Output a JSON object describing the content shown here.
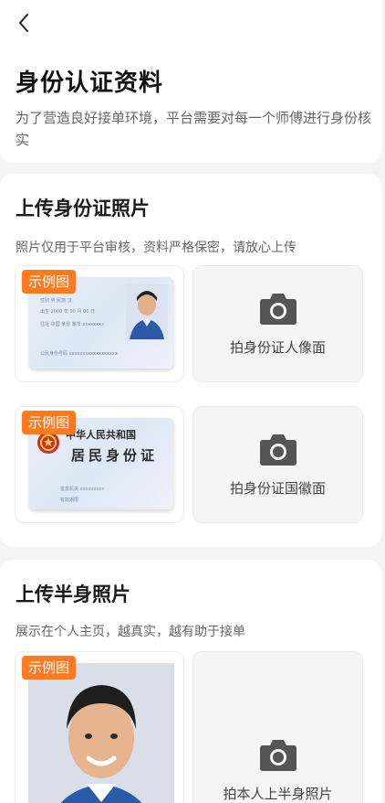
{
  "header": {
    "back_icon": "chevron-left-icon",
    "title": "身份认证资料",
    "description": "为了营造良好接单环境，平台需要对每一个师傅进行身份核实"
  },
  "id_section": {
    "title": "上传身份证照片",
    "description": "照片仅用于平台审核，资料严格保密，请放心上传",
    "sample_tag": "示例图",
    "front_upload_label": "拍身份证人像面",
    "back_upload_label": "拍身份证国徽面",
    "card_back_title": "中华人民共和国",
    "card_back_subtitle": "居民身份证"
  },
  "half_section": {
    "title": "上传半身照片",
    "description": "展示在个人主页，越真实，越有助于接单",
    "sample_tag": "示例图",
    "upload_label": "拍本人上半身照片"
  },
  "colors": {
    "accent": "#ff7a1f",
    "background": "#f4f4f4",
    "camera": "#555555"
  }
}
